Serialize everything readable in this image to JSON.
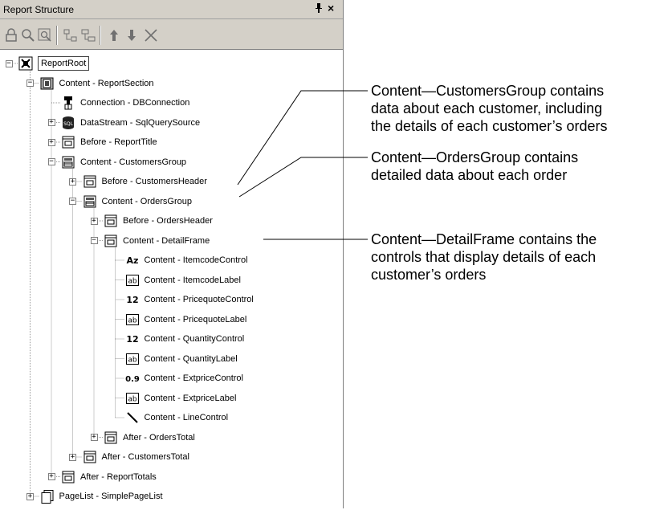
{
  "panel": {
    "title": "Report Structure",
    "pin_glyph": "∑",
    "close_glyph": "×"
  },
  "toolbar": {
    "buttons": [
      {
        "icon": "lock-icon"
      },
      {
        "icon": "zoom-icon"
      },
      {
        "icon": "zoom-region-icon"
      },
      {
        "icon": "collapse-tree-icon"
      },
      {
        "icon": "expand-tree-icon"
      },
      {
        "icon": "move-up-icon"
      },
      {
        "icon": "move-down-icon"
      },
      {
        "icon": "delete-icon"
      }
    ]
  },
  "tree": [
    {
      "label": "ReportRoot",
      "level": 0,
      "expander": "-",
      "icon": "report-root-icon"
    },
    {
      "label": "Content - ReportSection",
      "level": 1,
      "expander": "-",
      "icon": "section-icon"
    },
    {
      "label": "Connection - DBConnection",
      "level": 2,
      "expander": "",
      "icon": "connection-icon"
    },
    {
      "label": "DataStream - SqlQuerySource",
      "level": 2,
      "expander": "+",
      "icon": "sql-icon"
    },
    {
      "label": "Before - ReportTitle",
      "level": 2,
      "expander": "+",
      "icon": "frame-icon"
    },
    {
      "label": "Content - CustomersGroup",
      "level": 2,
      "expander": "-",
      "icon": "group-icon"
    },
    {
      "label": "Before - CustomersHeader",
      "level": 3,
      "expander": "+",
      "icon": "frame-icon"
    },
    {
      "label": "Content - OrdersGroup",
      "level": 3,
      "expander": "-",
      "icon": "group-icon"
    },
    {
      "label": "Before - OrdersHeader",
      "level": 4,
      "expander": "+",
      "icon": "frame-icon"
    },
    {
      "label": "Content - DetailFrame",
      "level": 4,
      "expander": "-",
      "icon": "frame-icon"
    },
    {
      "label": "Content - ItemcodeControl",
      "level": 5,
      "expander": "",
      "icon": "text-control-icon"
    },
    {
      "label": "Content - ItemcodeLabel",
      "level": 5,
      "expander": "",
      "icon": "label-icon"
    },
    {
      "label": "Content - PricequoteControl",
      "level": 5,
      "expander": "",
      "icon": "integer-control-icon"
    },
    {
      "label": "Content - PricequoteLabel",
      "level": 5,
      "expander": "",
      "icon": "label-icon"
    },
    {
      "label": "Content - QuantityControl",
      "level": 5,
      "expander": "",
      "icon": "integer-control-icon"
    },
    {
      "label": "Content - QuantityLabel",
      "level": 5,
      "expander": "",
      "icon": "label-icon"
    },
    {
      "label": "Content - ExtpriceControl",
      "level": 5,
      "expander": "",
      "icon": "decimal-control-icon"
    },
    {
      "label": "Content - ExtpriceLabel",
      "level": 5,
      "expander": "",
      "icon": "label-icon"
    },
    {
      "label": "Content - LineControl",
      "level": 5,
      "expander": "",
      "icon": "line-control-icon"
    },
    {
      "label": "After - OrdersTotal",
      "level": 4,
      "expander": "+",
      "icon": "frame-icon"
    },
    {
      "label": "After - CustomersTotal",
      "level": 3,
      "expander": "+",
      "icon": "frame-icon"
    },
    {
      "label": "After - ReportTotals",
      "level": 2,
      "expander": "+",
      "icon": "frame-icon"
    },
    {
      "label": "PageList - SimplePageList",
      "level": 1,
      "expander": "+",
      "icon": "pagelist-icon"
    }
  ],
  "icon_text": {
    "text_control": "Az",
    "label": "ab",
    "integer": "12",
    "decimal": "0.9"
  },
  "callouts": [
    {
      "lines": [
        "Content—CustomersGroup contains",
        "data about each customer, including",
        "the details of each customer’s orders"
      ]
    },
    {
      "lines": [
        "Content—OrdersGroup contains",
        "detailed data about each order"
      ]
    },
    {
      "lines": [
        "Content—DetailFrame contains the",
        "controls that display details of each",
        "customer’s orders"
      ]
    }
  ]
}
